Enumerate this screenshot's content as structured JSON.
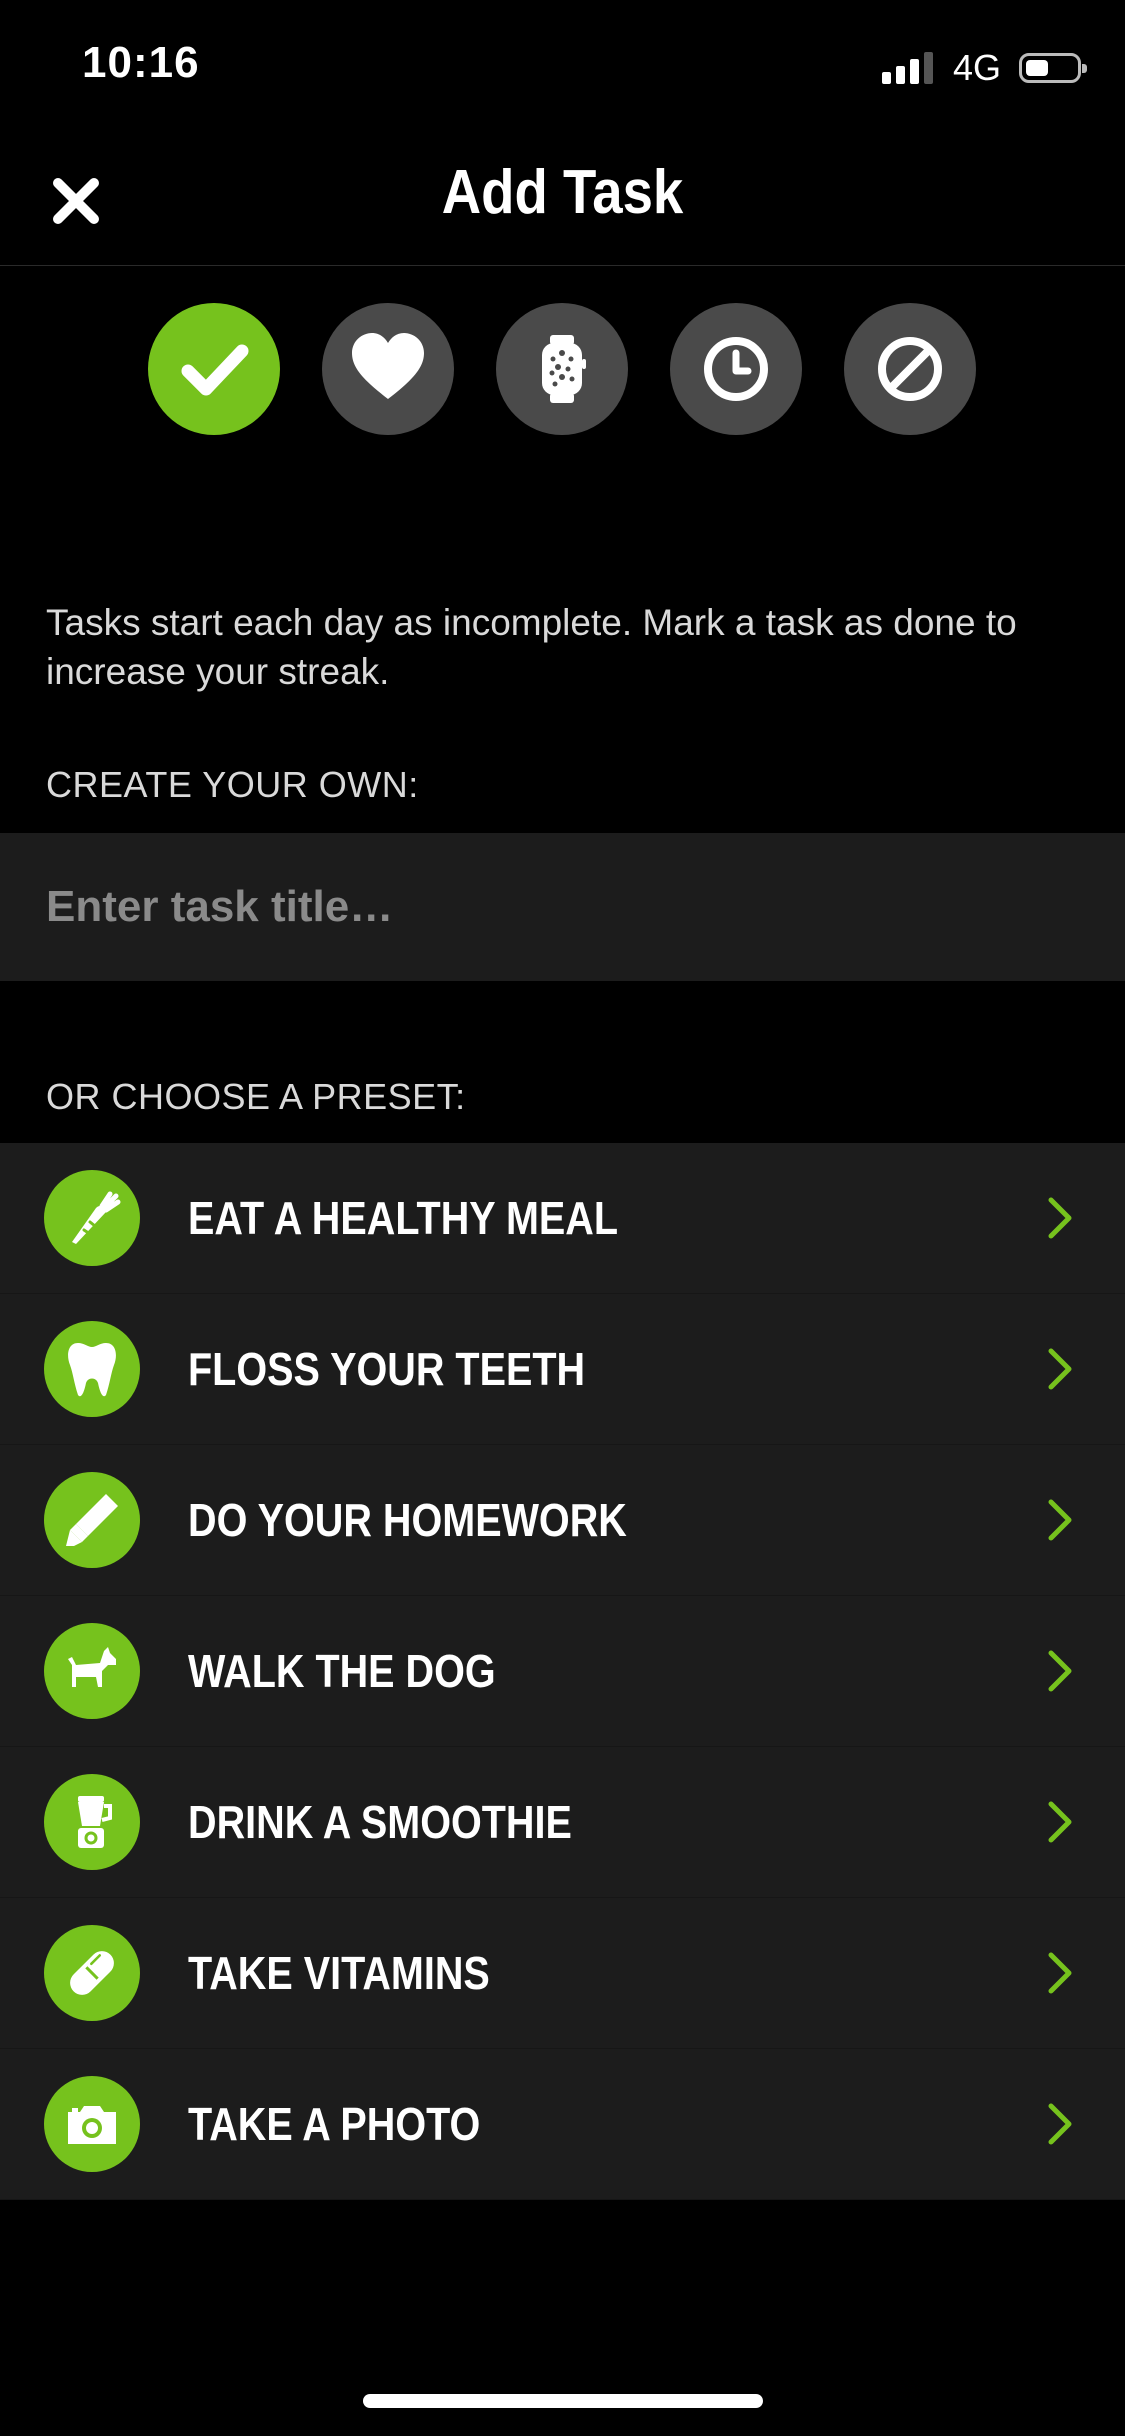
{
  "status_bar": {
    "time": "10:16",
    "network": "4G"
  },
  "header": {
    "title": "Add Task"
  },
  "task_types": [
    {
      "name": "check-icon",
      "active": true
    },
    {
      "name": "heart-icon",
      "active": false
    },
    {
      "name": "watch-icon",
      "active": false
    },
    {
      "name": "clock-icon",
      "active": false
    },
    {
      "name": "prohibited-icon",
      "active": false
    }
  ],
  "description": "Tasks start each day as incomplete. Mark a task as done to increase your streak.",
  "create_section": {
    "label": "CREATE YOUR OWN:",
    "placeholder": "Enter task title…",
    "value": ""
  },
  "preset_section": {
    "label": "OR CHOOSE A PRESET:"
  },
  "presets": [
    {
      "label": "EAT A HEALTHY MEAL",
      "icon": "carrot-icon"
    },
    {
      "label": "FLOSS YOUR TEETH",
      "icon": "tooth-icon"
    },
    {
      "label": "DO YOUR HOMEWORK",
      "icon": "highlighter-icon"
    },
    {
      "label": "WALK THE DOG",
      "icon": "dog-icon"
    },
    {
      "label": "DRINK A SMOOTHIE",
      "icon": "blender-icon"
    },
    {
      "label": "TAKE VITAMINS",
      "icon": "pill-icon"
    },
    {
      "label": "TAKE A PHOTO",
      "icon": "camera-icon"
    }
  ],
  "colors": {
    "accent": "#76c21d",
    "inactive_circle": "#4a4a4a",
    "row_bg": "#1c1c1c",
    "background": "#000000"
  }
}
